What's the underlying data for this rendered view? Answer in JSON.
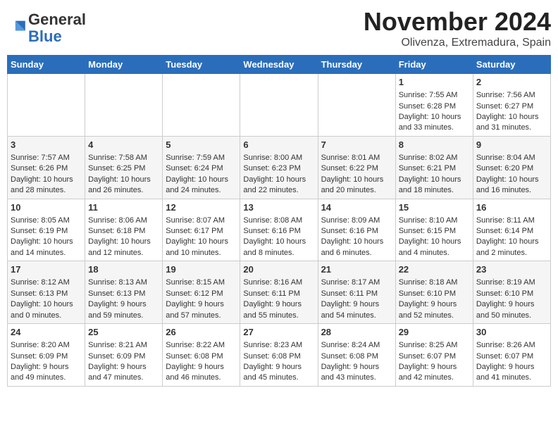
{
  "header": {
    "logo_general": "General",
    "logo_blue": "Blue",
    "month": "November 2024",
    "location": "Olivenza, Extremadura, Spain"
  },
  "calendar": {
    "headers": [
      "Sunday",
      "Monday",
      "Tuesday",
      "Wednesday",
      "Thursday",
      "Friday",
      "Saturday"
    ],
    "rows": [
      [
        {
          "day": "",
          "info": ""
        },
        {
          "day": "",
          "info": ""
        },
        {
          "day": "",
          "info": ""
        },
        {
          "day": "",
          "info": ""
        },
        {
          "day": "",
          "info": ""
        },
        {
          "day": "1",
          "info": "Sunrise: 7:55 AM\nSunset: 6:28 PM\nDaylight: 10 hours and 33 minutes."
        },
        {
          "day": "2",
          "info": "Sunrise: 7:56 AM\nSunset: 6:27 PM\nDaylight: 10 hours and 31 minutes."
        }
      ],
      [
        {
          "day": "3",
          "info": "Sunrise: 7:57 AM\nSunset: 6:26 PM\nDaylight: 10 hours and 28 minutes."
        },
        {
          "day": "4",
          "info": "Sunrise: 7:58 AM\nSunset: 6:25 PM\nDaylight: 10 hours and 26 minutes."
        },
        {
          "day": "5",
          "info": "Sunrise: 7:59 AM\nSunset: 6:24 PM\nDaylight: 10 hours and 24 minutes."
        },
        {
          "day": "6",
          "info": "Sunrise: 8:00 AM\nSunset: 6:23 PM\nDaylight: 10 hours and 22 minutes."
        },
        {
          "day": "7",
          "info": "Sunrise: 8:01 AM\nSunset: 6:22 PM\nDaylight: 10 hours and 20 minutes."
        },
        {
          "day": "8",
          "info": "Sunrise: 8:02 AM\nSunset: 6:21 PM\nDaylight: 10 hours and 18 minutes."
        },
        {
          "day": "9",
          "info": "Sunrise: 8:04 AM\nSunset: 6:20 PM\nDaylight: 10 hours and 16 minutes."
        }
      ],
      [
        {
          "day": "10",
          "info": "Sunrise: 8:05 AM\nSunset: 6:19 PM\nDaylight: 10 hours and 14 minutes."
        },
        {
          "day": "11",
          "info": "Sunrise: 8:06 AM\nSunset: 6:18 PM\nDaylight: 10 hours and 12 minutes."
        },
        {
          "day": "12",
          "info": "Sunrise: 8:07 AM\nSunset: 6:17 PM\nDaylight: 10 hours and 10 minutes."
        },
        {
          "day": "13",
          "info": "Sunrise: 8:08 AM\nSunset: 6:16 PM\nDaylight: 10 hours and 8 minutes."
        },
        {
          "day": "14",
          "info": "Sunrise: 8:09 AM\nSunset: 6:16 PM\nDaylight: 10 hours and 6 minutes."
        },
        {
          "day": "15",
          "info": "Sunrise: 8:10 AM\nSunset: 6:15 PM\nDaylight: 10 hours and 4 minutes."
        },
        {
          "day": "16",
          "info": "Sunrise: 8:11 AM\nSunset: 6:14 PM\nDaylight: 10 hours and 2 minutes."
        }
      ],
      [
        {
          "day": "17",
          "info": "Sunrise: 8:12 AM\nSunset: 6:13 PM\nDaylight: 10 hours and 0 minutes."
        },
        {
          "day": "18",
          "info": "Sunrise: 8:13 AM\nSunset: 6:13 PM\nDaylight: 9 hours and 59 minutes."
        },
        {
          "day": "19",
          "info": "Sunrise: 8:15 AM\nSunset: 6:12 PM\nDaylight: 9 hours and 57 minutes."
        },
        {
          "day": "20",
          "info": "Sunrise: 8:16 AM\nSunset: 6:11 PM\nDaylight: 9 hours and 55 minutes."
        },
        {
          "day": "21",
          "info": "Sunrise: 8:17 AM\nSunset: 6:11 PM\nDaylight: 9 hours and 54 minutes."
        },
        {
          "day": "22",
          "info": "Sunrise: 8:18 AM\nSunset: 6:10 PM\nDaylight: 9 hours and 52 minutes."
        },
        {
          "day": "23",
          "info": "Sunrise: 8:19 AM\nSunset: 6:10 PM\nDaylight: 9 hours and 50 minutes."
        }
      ],
      [
        {
          "day": "24",
          "info": "Sunrise: 8:20 AM\nSunset: 6:09 PM\nDaylight: 9 hours and 49 minutes."
        },
        {
          "day": "25",
          "info": "Sunrise: 8:21 AM\nSunset: 6:09 PM\nDaylight: 9 hours and 47 minutes."
        },
        {
          "day": "26",
          "info": "Sunrise: 8:22 AM\nSunset: 6:08 PM\nDaylight: 9 hours and 46 minutes."
        },
        {
          "day": "27",
          "info": "Sunrise: 8:23 AM\nSunset: 6:08 PM\nDaylight: 9 hours and 45 minutes."
        },
        {
          "day": "28",
          "info": "Sunrise: 8:24 AM\nSunset: 6:08 PM\nDaylight: 9 hours and 43 minutes."
        },
        {
          "day": "29",
          "info": "Sunrise: 8:25 AM\nSunset: 6:07 PM\nDaylight: 9 hours and 42 minutes."
        },
        {
          "day": "30",
          "info": "Sunrise: 8:26 AM\nSunset: 6:07 PM\nDaylight: 9 hours and 41 minutes."
        }
      ]
    ]
  }
}
